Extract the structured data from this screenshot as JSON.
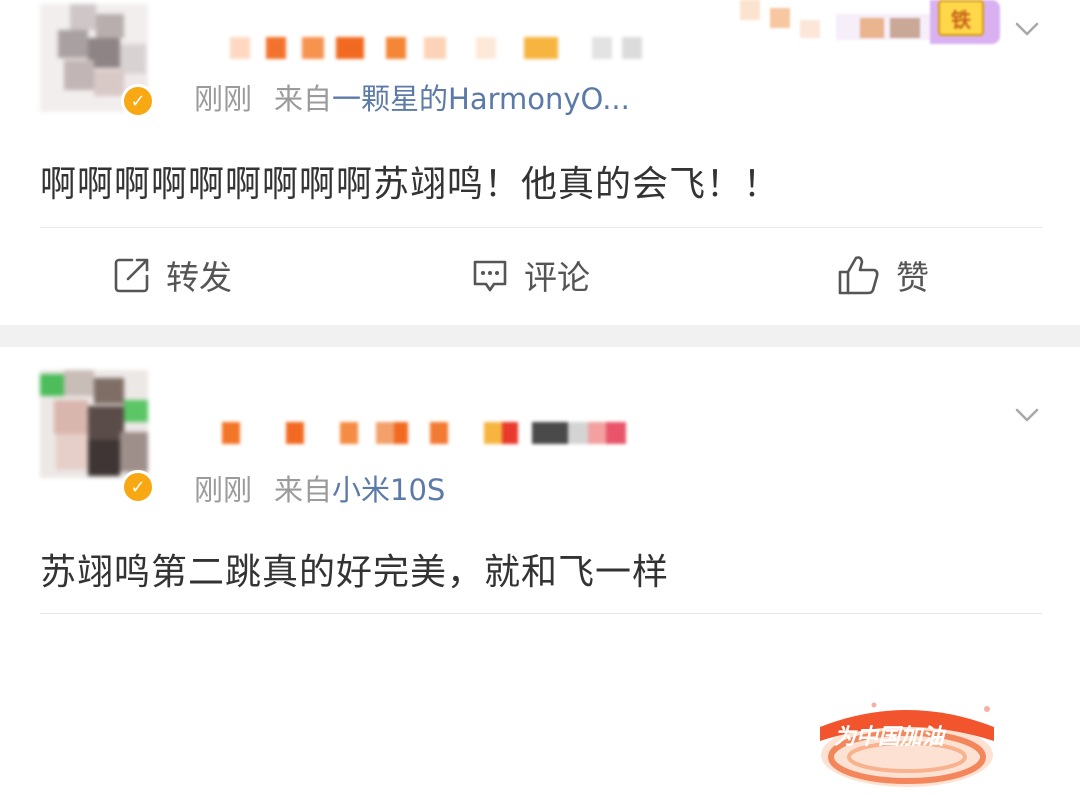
{
  "posts": [
    {
      "time": "刚刚",
      "source_prefix": "来自",
      "source": "一颗星的HarmonyO...",
      "content": "啊啊啊啊啊啊啊啊啊苏翊鸣！他真的会飞！！",
      "actions": {
        "repost": "转发",
        "comment": "评论",
        "like": "赞"
      },
      "sticker_text": "铁"
    },
    {
      "time": "刚刚",
      "source_prefix": "来自",
      "source": "小米10S",
      "content": "苏翊鸣第二跳真的好完美，就和飞一样",
      "sticker_text": "为中国加油"
    }
  ],
  "colors": {
    "meta_gray": "#9b9b9b",
    "source_blue": "#5b7aa8",
    "badge_orange": "#f7a812",
    "separator": "#f1f1f1",
    "text_dark": "#333333"
  },
  "icons": [
    "verified-badge-icon",
    "chevron-down-icon",
    "repost-icon",
    "comment-icon",
    "like-icon"
  ]
}
